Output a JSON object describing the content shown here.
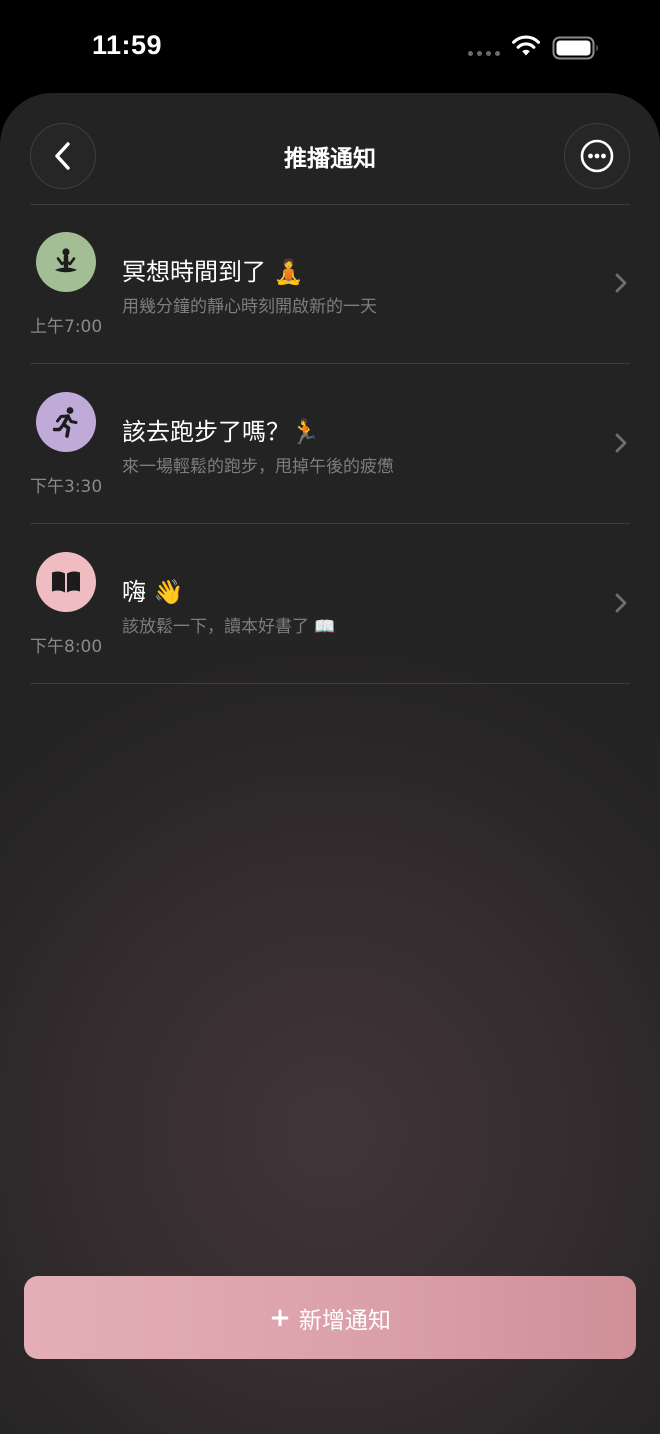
{
  "status_bar": {
    "time": "11:59"
  },
  "header": {
    "title": "推播通知"
  },
  "colors": {
    "avatar_meditation": "#a3bd95",
    "avatar_running": "#bfaad8",
    "avatar_book": "#efbcc2",
    "accent_button": "#dba1a9"
  },
  "notifications": [
    {
      "icon": "meditation-icon",
      "time": "上午7:00",
      "title": "冥想時間到了 🧘",
      "subtitle": "用幾分鐘的靜心時刻開啟新的一天"
    },
    {
      "icon": "running-icon",
      "time": "下午3:30",
      "title": "該去跑步了嗎？🏃",
      "subtitle": "來一場輕鬆的跑步，甩掉午後的疲憊"
    },
    {
      "icon": "book-icon",
      "time": "下午8:00",
      "title": "嗨 👋",
      "subtitle": "該放鬆一下，讀本好書了 📖"
    }
  ],
  "add_button": {
    "plus": "+",
    "label": "新增通知"
  }
}
